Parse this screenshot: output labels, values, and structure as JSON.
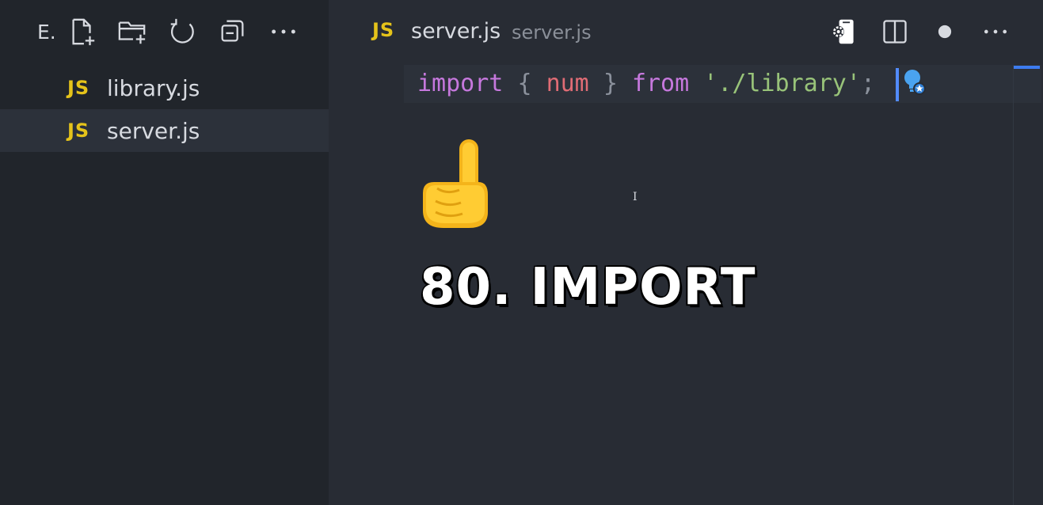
{
  "sidebar": {
    "title": "E.",
    "actions": [
      {
        "name": "new-file-icon"
      },
      {
        "name": "new-folder-icon"
      },
      {
        "name": "refresh-icon"
      },
      {
        "name": "collapse-all-icon"
      },
      {
        "name": "more-icon"
      }
    ],
    "files": [
      {
        "badge": "JS",
        "label": "library.js",
        "active": false
      },
      {
        "badge": "JS",
        "label": "server.js",
        "active": true
      }
    ]
  },
  "tab": {
    "badge": "JS",
    "name": "server.js",
    "description": "server.js"
  },
  "editor_actions": [
    "remote-device-icon",
    "split-editor-icon",
    "unsaved-dot-icon",
    "more-icon"
  ],
  "code": {
    "keyword_import": "import",
    "brace_open": "{",
    "identifier": "num",
    "brace_close": "}",
    "keyword_from": "from",
    "string": "'./library'",
    "semicolon": ";"
  },
  "overlay": {
    "emoji": "pointing-up-hand",
    "caption": "80. IMPORT"
  },
  "colors": {
    "js_badge": "#e5c31a",
    "keyword": "#c678dd",
    "variable": "#e06c75",
    "string": "#98c379",
    "cursor": "#528bff"
  }
}
